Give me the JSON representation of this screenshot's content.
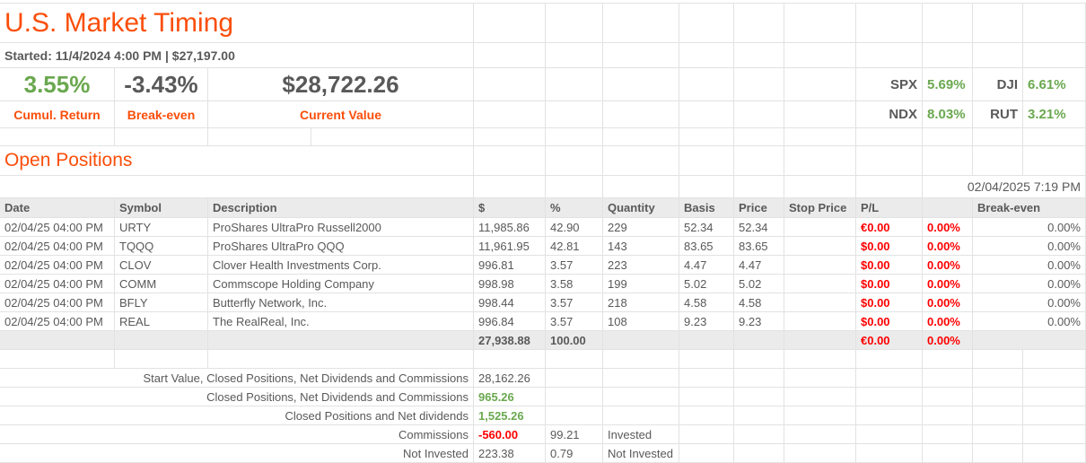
{
  "header": {
    "title": "U.S. Market Timing",
    "started_line": "Started: 11/4/2024 4:00 PM | $27,197.00"
  },
  "stats": {
    "cumul_return": {
      "value": "3.55%",
      "label": "Cumul. Return"
    },
    "break_even": {
      "value": "-3.43%",
      "label": "Break-even"
    },
    "current_value": {
      "value": "$28,722.26",
      "label": "Current Value"
    }
  },
  "indices": {
    "spx": {
      "label": "SPX",
      "value": "5.69%"
    },
    "dji": {
      "label": "DJI",
      "value": "6.61%"
    },
    "ndx": {
      "label": "NDX",
      "value": "8.03%"
    },
    "rut": {
      "label": "RUT",
      "value": "3.21%"
    }
  },
  "open_positions": {
    "section_title": "Open Positions",
    "timestamp": "02/04/2025 7:19 PM",
    "columns": [
      "Date",
      "Symbol",
      "Description",
      "$",
      "%",
      "Quantity",
      "Basis",
      "Price",
      "Stop Price",
      "P/L",
      "Break-even"
    ],
    "rows": [
      {
        "date": "02/04/25 04:00 PM",
        "symbol": "URTY",
        "description": "ProShares UltraPro Russell2000",
        "usd": "11,985.86",
        "pct": "42.90",
        "quantity": "229",
        "basis": "52.34",
        "price": "52.34",
        "stop_price": "",
        "pl": "€0.00",
        "pl_pct": "0.00%",
        "break_even": "0.00%"
      },
      {
        "date": "02/04/25 04:00 PM",
        "symbol": "TQQQ",
        "description": "ProShares UltraPro QQQ",
        "usd": "11,961.95",
        "pct": "42.81",
        "quantity": "143",
        "basis": "83.65",
        "price": "83.65",
        "stop_price": "",
        "pl": "$0.00",
        "pl_pct": "0.00%",
        "break_even": "0.00%"
      },
      {
        "date": "02/04/25 04:00 PM",
        "symbol": "CLOV",
        "description": "Clover Health Investments Corp.",
        "usd": "996.81",
        "pct": "3.57",
        "quantity": "223",
        "basis": "4.47",
        "price": "4.47",
        "stop_price": "",
        "pl": "$0.00",
        "pl_pct": "0.00%",
        "break_even": "0.00%"
      },
      {
        "date": "02/04/25 04:00 PM",
        "symbol": "COMM",
        "description": "Commscope Holding Company",
        "usd": "998.98",
        "pct": "3.58",
        "quantity": "199",
        "basis": "5.02",
        "price": "5.02",
        "stop_price": "",
        "pl": "$0.00",
        "pl_pct": "0.00%",
        "break_even": "0.00%"
      },
      {
        "date": "02/04/25 04:00 PM",
        "symbol": "BFLY",
        "description": "Butterfly Network, Inc.",
        "usd": "998.44",
        "pct": "3.57",
        "quantity": "218",
        "basis": "4.58",
        "price": "4.58",
        "stop_price": "",
        "pl": "$0.00",
        "pl_pct": "0.00%",
        "break_even": "0.00%"
      },
      {
        "date": "02/04/25 04:00 PM",
        "symbol": "REAL",
        "description": "The RealReal, Inc.",
        "usd": "996.84",
        "pct": "3.57",
        "quantity": "108",
        "basis": "9.23",
        "price": "9.23",
        "stop_price": "",
        "pl": "$0.00",
        "pl_pct": "0.00%",
        "break_even": "0.00%"
      }
    ],
    "total": {
      "usd": "27,938.88",
      "pct": "100.00",
      "pl": "€0.00",
      "pl_pct": "0.00%"
    }
  },
  "summary": {
    "rows": [
      {
        "label": "Start Value, Closed Positions, Net Dividends and Commissions",
        "value": "28,162.26",
        "tone": "plain",
        "pct": "",
        "note": ""
      },
      {
        "label": "Closed Positions, Net Dividends and Commissions",
        "value": "965.26",
        "tone": "green",
        "pct": "",
        "note": ""
      },
      {
        "label": "Closed Positions and Net dividends",
        "value": "1,525.26",
        "tone": "green",
        "pct": "",
        "note": ""
      },
      {
        "label": "Commissions",
        "value": "-560.00",
        "tone": "red",
        "pct": "99.21",
        "note": "Invested"
      },
      {
        "label": "Not Invested",
        "value": "223.38",
        "tone": "plain",
        "pct": "0.79",
        "note": "Not Invested"
      }
    ]
  },
  "colors": {
    "accent_orange": "#fb4e0a",
    "positive_green": "#6aa84f",
    "negative_red": "#ff0000",
    "text_gray": "#595959",
    "gridline": "#e2e2e2",
    "band_gray": "#ebebeb"
  }
}
